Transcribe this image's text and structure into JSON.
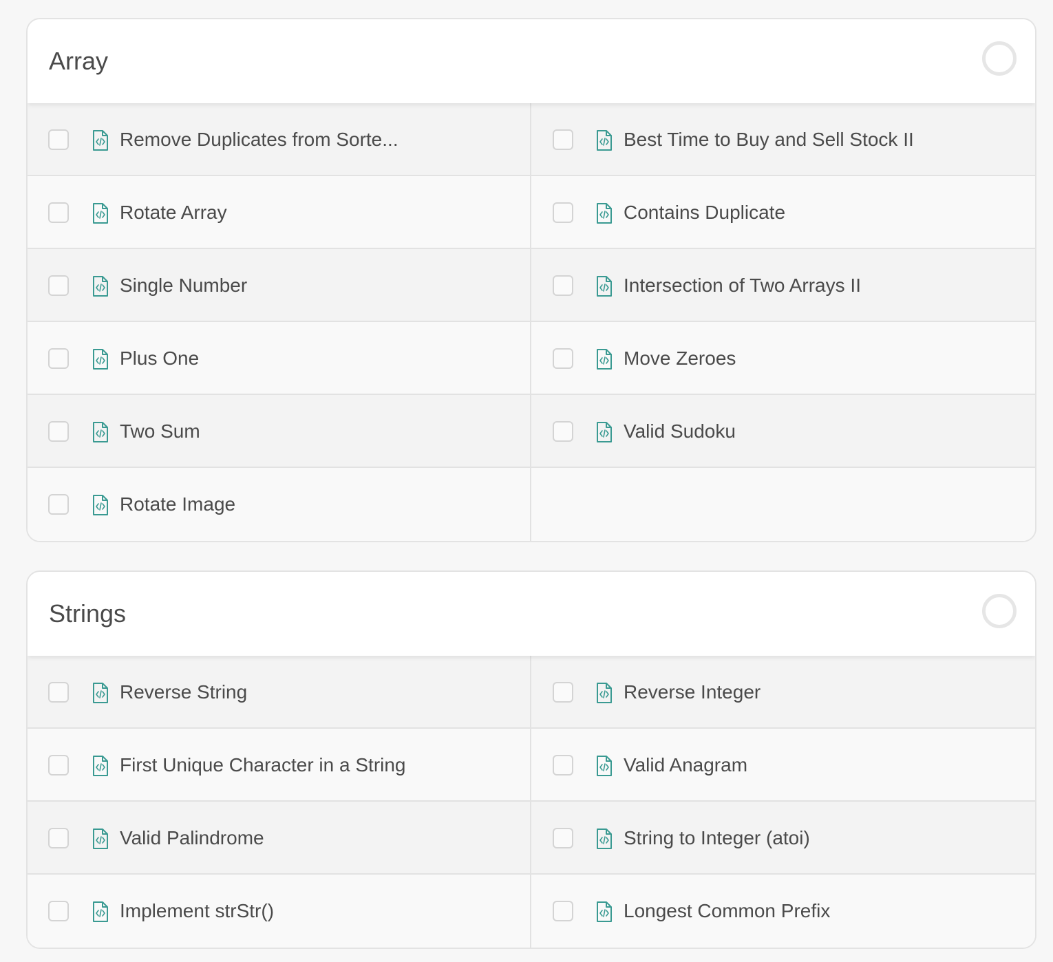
{
  "sections": [
    {
      "title": "Array",
      "problems": [
        {
          "label": "Remove Duplicates from Sorte...",
          "checked": false
        },
        {
          "label": "Best Time to Buy and Sell Stock II",
          "checked": false
        },
        {
          "label": "Rotate Array",
          "checked": false
        },
        {
          "label": "Contains Duplicate",
          "checked": false
        },
        {
          "label": "Single Number",
          "checked": false
        },
        {
          "label": "Intersection of Two Arrays II",
          "checked": false
        },
        {
          "label": "Plus One",
          "checked": false
        },
        {
          "label": "Move Zeroes",
          "checked": false
        },
        {
          "label": "Two Sum",
          "checked": false
        },
        {
          "label": "Valid Sudoku",
          "checked": false
        },
        {
          "label": "Rotate Image",
          "checked": false
        }
      ]
    },
    {
      "title": "Strings",
      "problems": [
        {
          "label": "Reverse String",
          "checked": false
        },
        {
          "label": "Reverse Integer",
          "checked": false
        },
        {
          "label": "First Unique Character in a String",
          "checked": false
        },
        {
          "label": "Valid Anagram",
          "checked": false
        },
        {
          "label": "Valid Palindrome",
          "checked": false
        },
        {
          "label": "String to Integer (atoi)",
          "checked": false
        },
        {
          "label": "Implement strStr()",
          "checked": false
        },
        {
          "label": "Longest Common Prefix",
          "checked": false
        }
      ]
    }
  ],
  "colors": {
    "icon": "#3a9a92",
    "checkbox_border": "#d4d4d4",
    "row_alt": "#f3f3f3",
    "row_base": "#f9f9f9"
  },
  "icons": {
    "problem": "code-file-icon",
    "progress": "progress-ring-icon"
  }
}
